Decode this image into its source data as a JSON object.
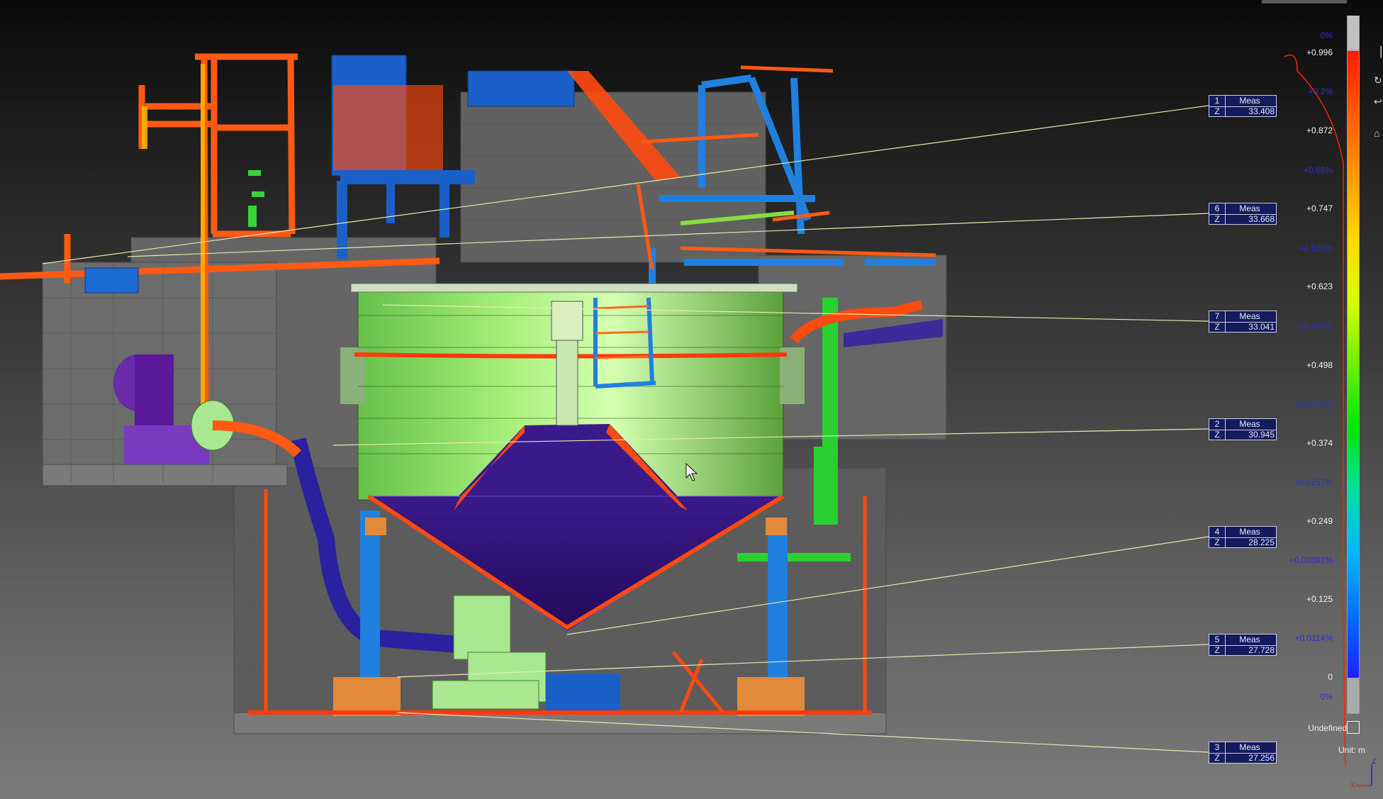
{
  "scale": {
    "title_pct": "0%",
    "ticks": [
      "+0.996",
      "+0.872",
      "+0.747",
      "+0.623",
      "+0.498",
      "+0.374",
      "+0.249",
      "+0.125",
      "0"
    ],
    "percentages": [
      "0%",
      "+0.2%",
      "+0.66%",
      "+0.503%",
      "+0.144%",
      "+0.0776%",
      "+0.0157%",
      "+0.00391%",
      "+0.0114%",
      "0%"
    ],
    "undefined_label": "Undefined",
    "unit_label": "Unit: m",
    "colors": {
      "high": "#ff1a00",
      "mid": "#00e800",
      "low": "#2020ff"
    }
  },
  "measurements": [
    {
      "id": "1",
      "label": "Meas",
      "axis": "Z",
      "value": "33.408"
    },
    {
      "id": "6",
      "label": "Meas",
      "axis": "Z",
      "value": "33.668"
    },
    {
      "id": "7",
      "label": "Meas",
      "axis": "Z",
      "value": "33.041"
    },
    {
      "id": "2",
      "label": "Meas",
      "axis": "Z",
      "value": "30.945"
    },
    {
      "id": "4",
      "label": "Meas",
      "axis": "Z",
      "value": "28.225"
    },
    {
      "id": "5",
      "label": "Meas",
      "axis": "Z",
      "value": "27.728"
    },
    {
      "id": "3",
      "label": "Meas",
      "axis": "Z",
      "value": "27.256"
    }
  ],
  "axes": {
    "z": "Z",
    "x": "X"
  },
  "icons": [
    "select-icon",
    "rotate-icon",
    "undo-icon",
    "home-icon"
  ]
}
